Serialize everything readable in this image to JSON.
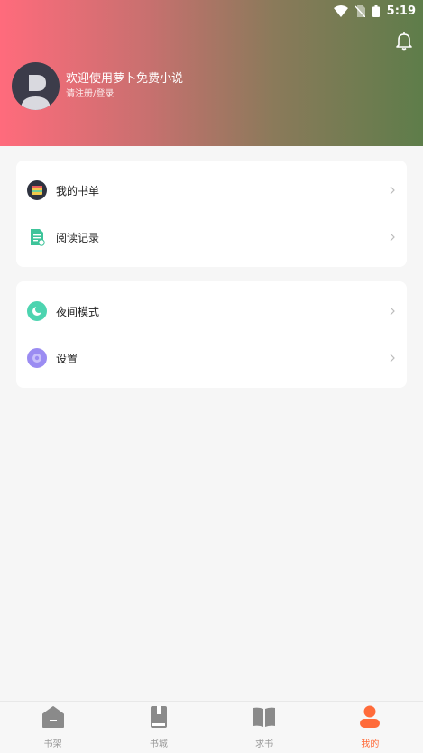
{
  "status": {
    "time": "5:19"
  },
  "header": {
    "welcome": "欢迎使用萝卜免费小说",
    "login": "请注册/登录"
  },
  "menu_group_1": [
    {
      "label": "我的书单",
      "icon": "booklist-icon"
    },
    {
      "label": "阅读记录",
      "icon": "reading-record-icon"
    }
  ],
  "menu_group_2": [
    {
      "label": "夜间模式",
      "icon": "night-mode-icon"
    },
    {
      "label": "设置",
      "icon": "settings-icon"
    }
  ],
  "tabs": [
    {
      "label": "书架",
      "icon": "bookshelf-icon"
    },
    {
      "label": "书城",
      "icon": "bookstore-icon"
    },
    {
      "label": "求书",
      "icon": "request-book-icon"
    },
    {
      "label": "我的",
      "icon": "profile-icon",
      "active": true
    }
  ],
  "colors": {
    "accent": "#ff6b3a",
    "header_left": "#ff6b7c",
    "header_right": "#5e7d4a"
  }
}
